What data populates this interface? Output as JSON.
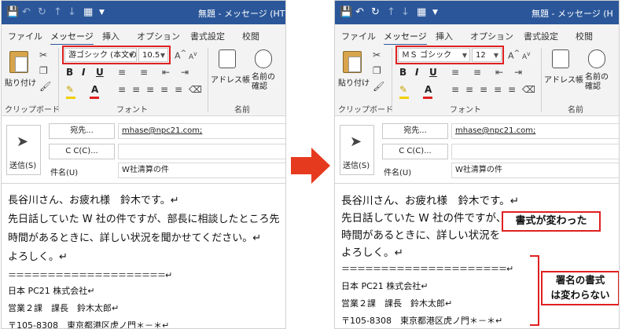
{
  "colors": {
    "titlebar": "#2b579a",
    "highlight": "#e02020",
    "arrow": "#e63a1f"
  },
  "left": {
    "window_title": "無題 - メッセージ (HT",
    "tabs": [
      "ファイル",
      "メッセージ",
      "挿入",
      "オプション",
      "書式設定",
      "校閲"
    ],
    "ribbon": {
      "paste_label": "貼り付け",
      "font_name": "游ゴシック (本文の",
      "font_size": "10.5",
      "clipboard_label": "クリップボード",
      "font_label": "フォント",
      "names_label": "名前",
      "address_book": "アドレス帳",
      "check_names": "名前の\n確認"
    },
    "compose": {
      "send_label": "送信(S)",
      "to_button": "宛先...",
      "cc_button": "C C(C)...",
      "subject_label": "件名(U)",
      "to_value": "mhase@npc21.com;",
      "subject_value": "W社清算の件"
    },
    "body": [
      "長谷川さん、お疲れ様　鈴木です。↵",
      "先日話していた W 社の件ですが、部長に相談したところ先",
      "時間があるときに、詳しい状況を聞かせてください。↵",
      "よろしく。↵",
      "＝＝＝＝＝＝＝＝＝＝＝＝＝＝＝＝＝＝＝＝↵",
      "日本 PC21 株式会社↵",
      "営業２課　課長　鈴木太郎↵",
      "〒105-8308　東京都港区虎ノ門＊－＊↵"
    ]
  },
  "right": {
    "window_title": "無題 - メッセージ (H",
    "tabs": [
      "ファイル",
      "メッセージ",
      "挿入",
      "オプション",
      "書式設定",
      "校閲"
    ],
    "ribbon": {
      "paste_label": "貼り付け",
      "font_name": "ＭＳ ゴシック",
      "font_size": "12",
      "clipboard_label": "クリップボード",
      "font_label": "フォント",
      "names_label": "名前",
      "address_book": "アドレス帳",
      "check_names": "名前の\n確認"
    },
    "compose": {
      "send_label": "送信(S)",
      "to_button": "宛先...",
      "cc_button": "C C(C)...",
      "subject_label": "件名(U)",
      "to_value": "mhase@npc21.com;",
      "subject_value": "W社清算の件"
    },
    "body": [
      "長谷川さん、お疲れ様　鈴木です。↵",
      "先日話していた W 社の件ですが、",
      "時間があるときに、詳しい状況を",
      "よろしく。↵",
      "＝＝＝＝＝＝＝＝＝＝＝＝＝＝＝＝＝＝＝＝＝↵",
      "日本 PC21 株式会社↵",
      "営業２課　課長　鈴木太郎↵",
      "〒105-8308　東京都港区虎ノ門＊－＊↵"
    ],
    "callouts": {
      "format_changed": "書式が変わった",
      "signature_unchanged": "署名の書式\nは変わらない"
    }
  }
}
